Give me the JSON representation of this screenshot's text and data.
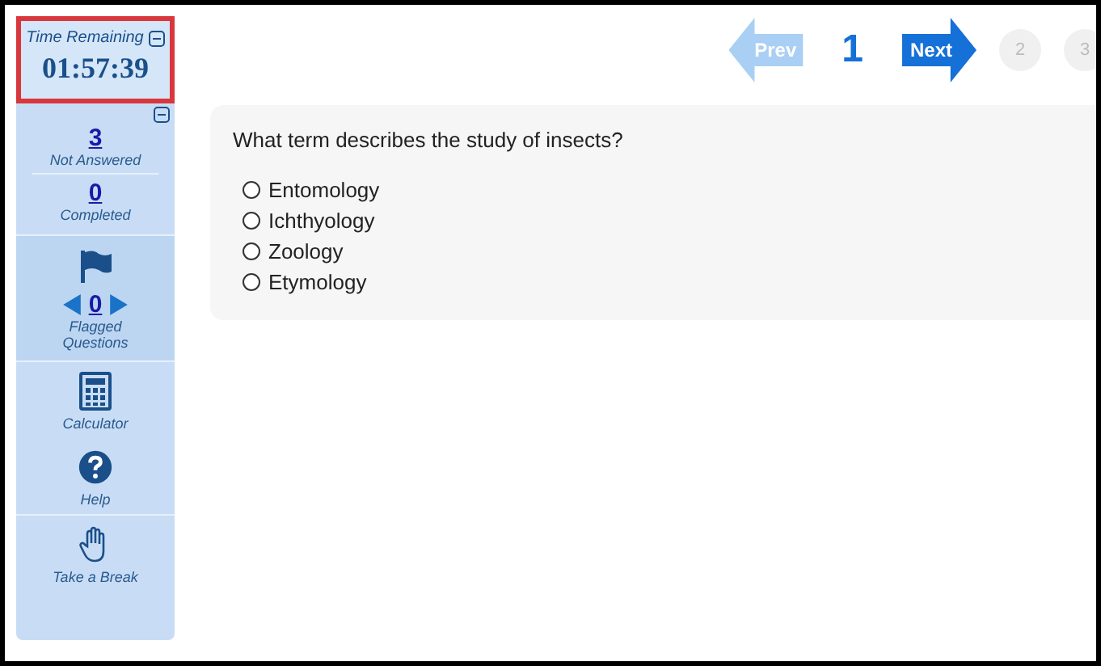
{
  "timer": {
    "label": "Time Remaining",
    "value": "01:57:39"
  },
  "status": [
    {
      "count": "3",
      "label": "Not Answered"
    },
    {
      "count": "0",
      "label": "Completed"
    }
  ],
  "flagged": {
    "count": "0",
    "label": "Flagged Questions"
  },
  "tools": [
    {
      "kind": "calculator",
      "label": "Calculator"
    },
    {
      "kind": "help",
      "label": "Help"
    },
    {
      "kind": "break",
      "label": "Take a Break"
    }
  ],
  "pagination": {
    "prev": {
      "label": "Prev",
      "disabled": true
    },
    "next": {
      "label": "Next",
      "disabled": false
    },
    "pages": [
      {
        "label": "1",
        "selected": true
      },
      {
        "label": "2",
        "selected": false
      },
      {
        "label": "3",
        "selected": false
      }
    ]
  },
  "question": {
    "text": "What term describes the study of insects?",
    "options": [
      {
        "label": "Entomology",
        "checked": false
      },
      {
        "label": "Ichthyology",
        "checked": false
      },
      {
        "label": "Zoology",
        "checked": false
      },
      {
        "label": "Etymology",
        "checked": false
      }
    ]
  }
}
